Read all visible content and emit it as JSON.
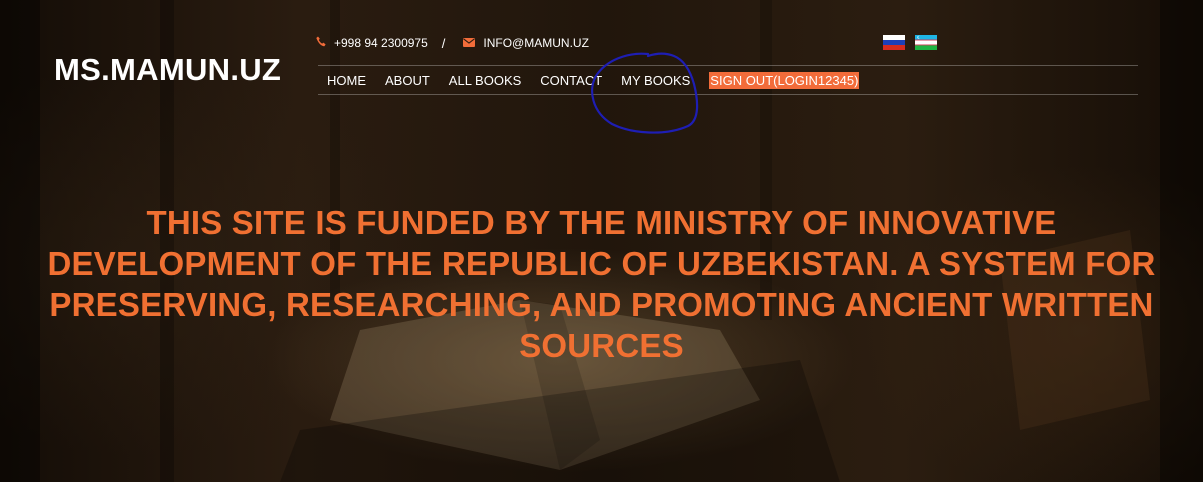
{
  "site": {
    "logo": "MS.MAMUN.UZ"
  },
  "contact": {
    "phone_icon": "phone-icon",
    "phone": "+998 94 2300975",
    "separator": "/",
    "email_icon": "envelope-icon",
    "email": "INFO@MAMUN.UZ"
  },
  "languages": [
    {
      "name": "russian-flag"
    },
    {
      "name": "uzbek-flag"
    }
  ],
  "nav": {
    "items": [
      {
        "label": "HOME"
      },
      {
        "label": "ABOUT"
      },
      {
        "label": "ALL BOOKS"
      },
      {
        "label": "CONTACT"
      },
      {
        "label": "MY BOOKS"
      }
    ],
    "signout_label": "SIGN OUT(LOGIN12345)"
  },
  "hero": {
    "headline": "THIS SITE IS FUNDED BY THE MINISTRY OF INNOVATIVE DEVELOPMENT OF THE REPUBLIC OF UZBEKISTAN. A SYSTEM FOR PRESERVING, RESEARCHING, AND PROMOTING ANCIENT WRITTEN SOURCES"
  },
  "colors": {
    "accent": "#f26c3a",
    "headline": "#f07032",
    "annotation": "#1e1eb4"
  }
}
